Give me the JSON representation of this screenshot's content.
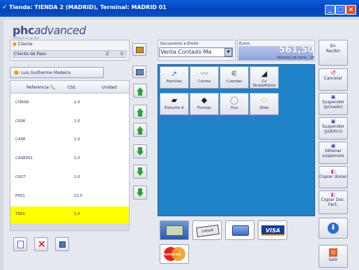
{
  "window": {
    "title": "Tienda: TIENDA 2 (MADRID), Terminal: MADRID 01",
    "minimize": "_",
    "maximize": "□",
    "close": "×"
  },
  "logo": {
    "main": "phc",
    "rest": "advanced",
    "tagline": "software de gestão"
  },
  "client": {
    "label": "Cliente",
    "name": "Cliente de Paso",
    "z": "Z",
    "number": "0"
  },
  "user": {
    "name": "Luis Guilherme Madeira"
  },
  "table": {
    "headers": {
      "ref": "Referencia",
      "qty": "Ctd.",
      "unit": "Unidad"
    },
    "rows": [
      {
        "ref": "CORSR",
        "qty": "1,0"
      },
      {
        "ref": "C006",
        "qty": "1,0"
      },
      {
        "ref": "CASE",
        "qty": "1,0"
      },
      {
        "ref": "CASE001",
        "qty": "1,0"
      },
      {
        "ref": "C007",
        "qty": "1,0"
      },
      {
        "ref": "P001",
        "qty": "12,0"
      },
      {
        "ref": "T001",
        "qty": "1,0"
      }
    ]
  },
  "document": {
    "label": "Documento a Emitir",
    "value": "Venta Contado Ma"
  },
  "totals": {
    "currency": "Euros",
    "amount": "561,50",
    "items_label": "Número de Itens : 18"
  },
  "products": [
    {
      "label": "Familias"
    },
    {
      "label": "Correa"
    },
    {
      "label": "Cuerdas"
    },
    {
      "label": "Cx StratoRitmo"
    },
    {
      "label": "Estuche A"
    },
    {
      "label": "Formas"
    },
    {
      "label": "Pua"
    },
    {
      "label": "Slide"
    }
  ],
  "payments": {
    "visa": "VISA",
    "mastercard": "MasterCard",
    "cheque": "CHEQUE"
  },
  "actions": {
    "receive": "Recibir",
    "cancel": "Cancelar",
    "suspend_private": "Suspender (privado)",
    "suspend_public": "Suspender (público)",
    "get_suspended": "Obtener suspensos",
    "copy_dossier": "Copiar dosier",
    "copy_doc": "Copiar Doc. Fact.",
    "exit": "Salir"
  },
  "colors": {
    "title": "#0643b8",
    "grid_blue": "#1e82c8",
    "selected_row": "#ffff00",
    "green": "#2e9e3a"
  }
}
